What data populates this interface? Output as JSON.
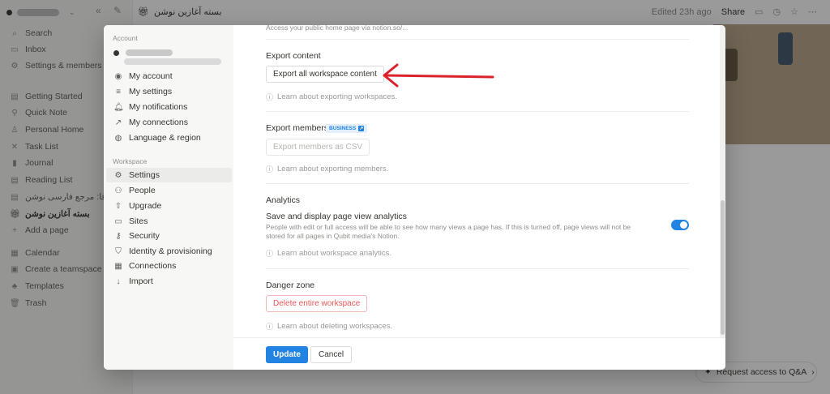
{
  "app": {
    "workspace_chevron": "⌄",
    "breadcrumb": "بسته آغازین نوشن",
    "edited": "Edited 23h ago",
    "share": "Share",
    "request_access": "Request access to Q&A"
  },
  "sidebar": {
    "items": [
      {
        "icon": "search-icon",
        "label": "Search"
      },
      {
        "icon": "inbox-icon",
        "label": "Inbox"
      },
      {
        "icon": "gear-icon",
        "label": "Settings & members"
      },
      {
        "icon": "page-icon",
        "label": "Getting Started"
      },
      {
        "icon": "pin-icon",
        "label": "Quick Note"
      },
      {
        "icon": "person-icon",
        "label": "Personal Home"
      },
      {
        "icon": "tasks-icon",
        "label": "Task List"
      },
      {
        "icon": "book-icon",
        "label": "Journal"
      },
      {
        "icon": "page-icon",
        "label": "Reading List"
      },
      {
        "icon": "page-icon",
        "label": "نوشن‌فا: مرجع فارسی نوشن"
      },
      {
        "icon": "gift-icon",
        "label": "بسته آغازین نوشن"
      },
      {
        "icon": "plus-icon",
        "label": "Add a page"
      },
      {
        "icon": "calendar-icon",
        "label": "Calendar"
      },
      {
        "icon": "team-icon",
        "label": "Create a teamspace"
      },
      {
        "icon": "templates-icon",
        "label": "Templates"
      },
      {
        "icon": "trash-icon",
        "label": "Trash"
      }
    ]
  },
  "modal": {
    "account_section": "Account",
    "account_items": [
      {
        "icon": "user-circle-icon",
        "label": "My account"
      },
      {
        "icon": "sliders-icon",
        "label": "My settings"
      },
      {
        "icon": "bell-icon",
        "label": "My notifications"
      },
      {
        "icon": "link-out-icon",
        "label": "My connections"
      },
      {
        "icon": "globe-icon",
        "label": "Language & region"
      }
    ],
    "workspace_section": "Workspace",
    "workspace_items": [
      {
        "icon": "gear-icon",
        "label": "Settings"
      },
      {
        "icon": "people-icon",
        "label": "People"
      },
      {
        "icon": "upgrade-icon",
        "label": "Upgrade"
      },
      {
        "icon": "sites-icon",
        "label": "Sites"
      },
      {
        "icon": "key-icon",
        "label": "Security"
      },
      {
        "icon": "shield-icon",
        "label": "Identity & provisioning"
      },
      {
        "icon": "grid-icon",
        "label": "Connections"
      },
      {
        "icon": "download-icon",
        "label": "Import"
      }
    ],
    "clipped_text": "Access your public home page via notion.so/...",
    "export_content": {
      "title": "Export content",
      "button": "Export all workspace content",
      "learn": "Learn about exporting workspaces."
    },
    "export_members": {
      "title": "Export members",
      "badge": "BUSINESS",
      "button": "Export members as CSV",
      "learn": "Learn about exporting members."
    },
    "analytics": {
      "title": "Analytics",
      "setting_label": "Save and display page view analytics",
      "description": "People with edit or full access will be able to see how many views a page has. If this is turned off, page views will not be stored for all pages in Qubit media's Notion.",
      "toggle_on": true,
      "learn": "Learn about workspace analytics."
    },
    "danger_zone": {
      "title": "Danger zone",
      "button": "Delete entire workspace",
      "learn": "Learn about deleting workspaces."
    },
    "footer": {
      "update": "Update",
      "cancel": "Cancel"
    }
  },
  "colors": {
    "accent": "#2383e2",
    "danger": "#eb5757",
    "arrow": "#d9222a"
  }
}
